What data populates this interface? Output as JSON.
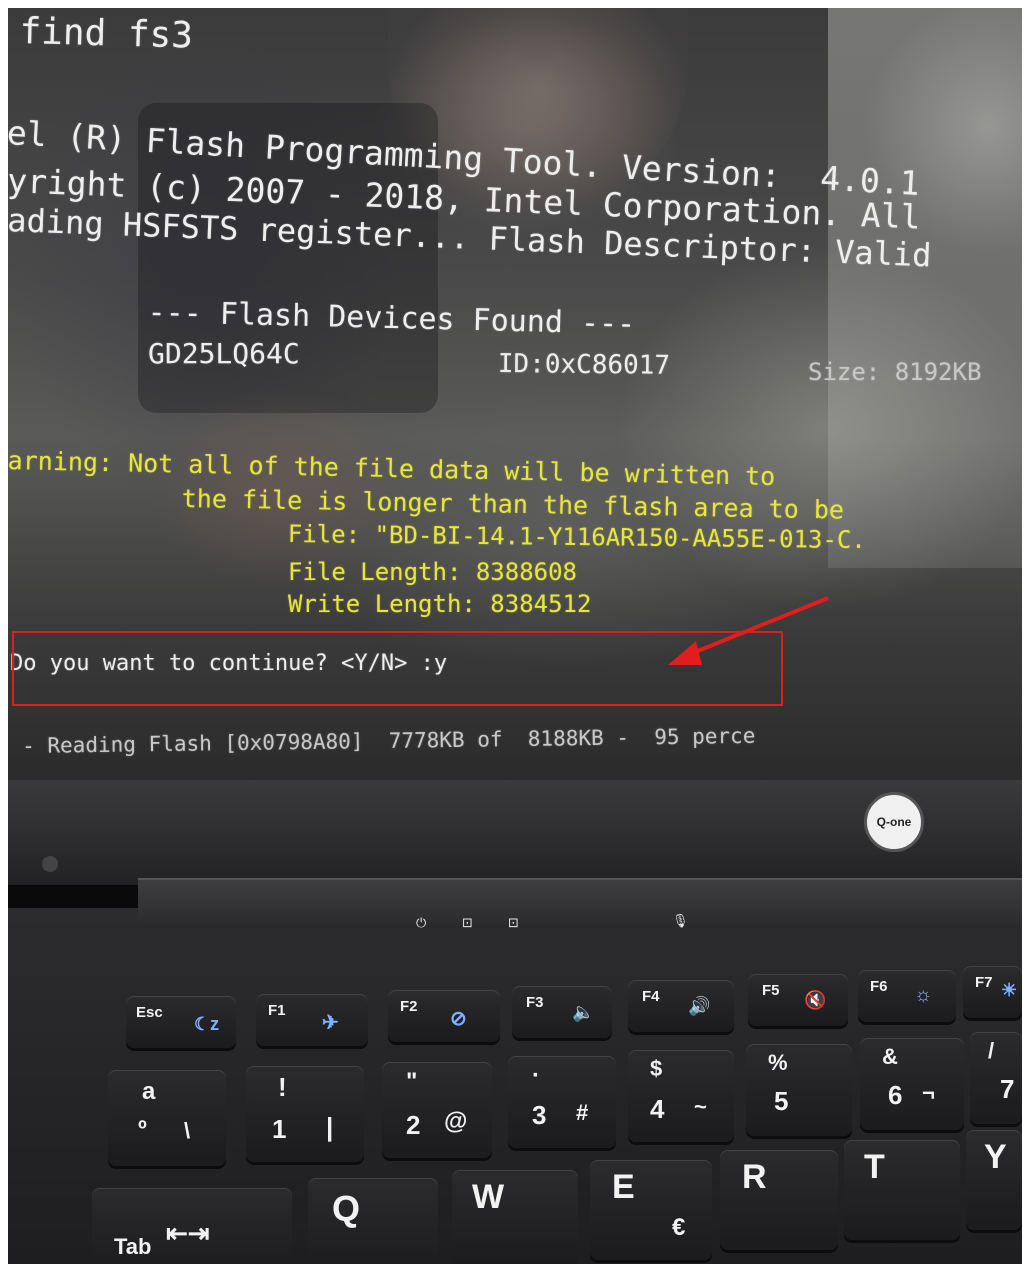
{
  "terminal": {
    "line_cmd": "find fs3",
    "line_title": "el (R) Flash Programming Tool. Version:  4.0.1",
    "line_copyright": "yright (c) 2007 - 2018, Intel Corporation. All",
    "line_reading": "ading HSFSTS register... Flash Descriptor: Valid",
    "devices_header": "--- Flash Devices Found ---",
    "device_name": "GD25LQ64C",
    "device_id": "ID:0xC86017",
    "device_size": "Size: 8192KB",
    "warning_line1": "arning: Not all of the file data will be written to",
    "warning_line2": "the file is longer than the flash area to be",
    "file_line": "File: \"BD-BI-14.1-Y116AR150-AA55E-013-C.",
    "file_length": "File Length: 8388608",
    "write_length": "Write Length: 8384512",
    "prompt": "Do you want to continue? <Y/N> :y",
    "progress": "- Reading Flash [0x0798A80]  7778KB of  8188KB -  95 perce"
  },
  "laptop": {
    "brand_logo": "Q-one"
  },
  "keyboard": {
    "fn_row": [
      {
        "label": "Esc",
        "icon": "sleep-icon",
        "glyph": "☾z"
      },
      {
        "label": "F1",
        "icon": "airplane-icon",
        "glyph": "✈"
      },
      {
        "label": "F2",
        "icon": "wifi-off-icon",
        "glyph": "⊘"
      },
      {
        "label": "F3",
        "icon": "volume-low-icon",
        "glyph": "🔈"
      },
      {
        "label": "F4",
        "icon": "volume-high-icon",
        "glyph": "🔊"
      },
      {
        "label": "F5",
        "icon": "mute-icon",
        "glyph": "🔇"
      },
      {
        "label": "F6",
        "icon": "brightness-down-icon",
        "glyph": "☼"
      },
      {
        "label": "F7",
        "icon": "brightness-up-icon",
        "glyph": "☀"
      }
    ],
    "num_row": [
      {
        "top": "a",
        "bottom": "º",
        "side": "\\"
      },
      {
        "top": "!",
        "bottom": "1",
        "side": "|"
      },
      {
        "top": "\"",
        "bottom": "2",
        "side": "@"
      },
      {
        "top": "·",
        "bottom": "3",
        "side": "#"
      },
      {
        "top": "$",
        "bottom": "4",
        "side": "~"
      },
      {
        "top": "%",
        "bottom": "5",
        "side": ""
      },
      {
        "top": "&",
        "bottom": "6",
        "side": "¬"
      },
      {
        "top": "/",
        "bottom": "7",
        "side": ""
      }
    ],
    "letter_row": [
      {
        "label": "Tab",
        "icon": "tab-icon",
        "glyph": "⇤⇥"
      },
      {
        "label": "Q"
      },
      {
        "label": "W"
      },
      {
        "label": "E",
        "side": "€"
      },
      {
        "label": "R"
      },
      {
        "label": "T"
      },
      {
        "label": "Y"
      }
    ]
  },
  "colors": {
    "terminal_text": "#eeeeee",
    "warning_text": "#e6e640",
    "annotation_red": "#e11d1d"
  }
}
